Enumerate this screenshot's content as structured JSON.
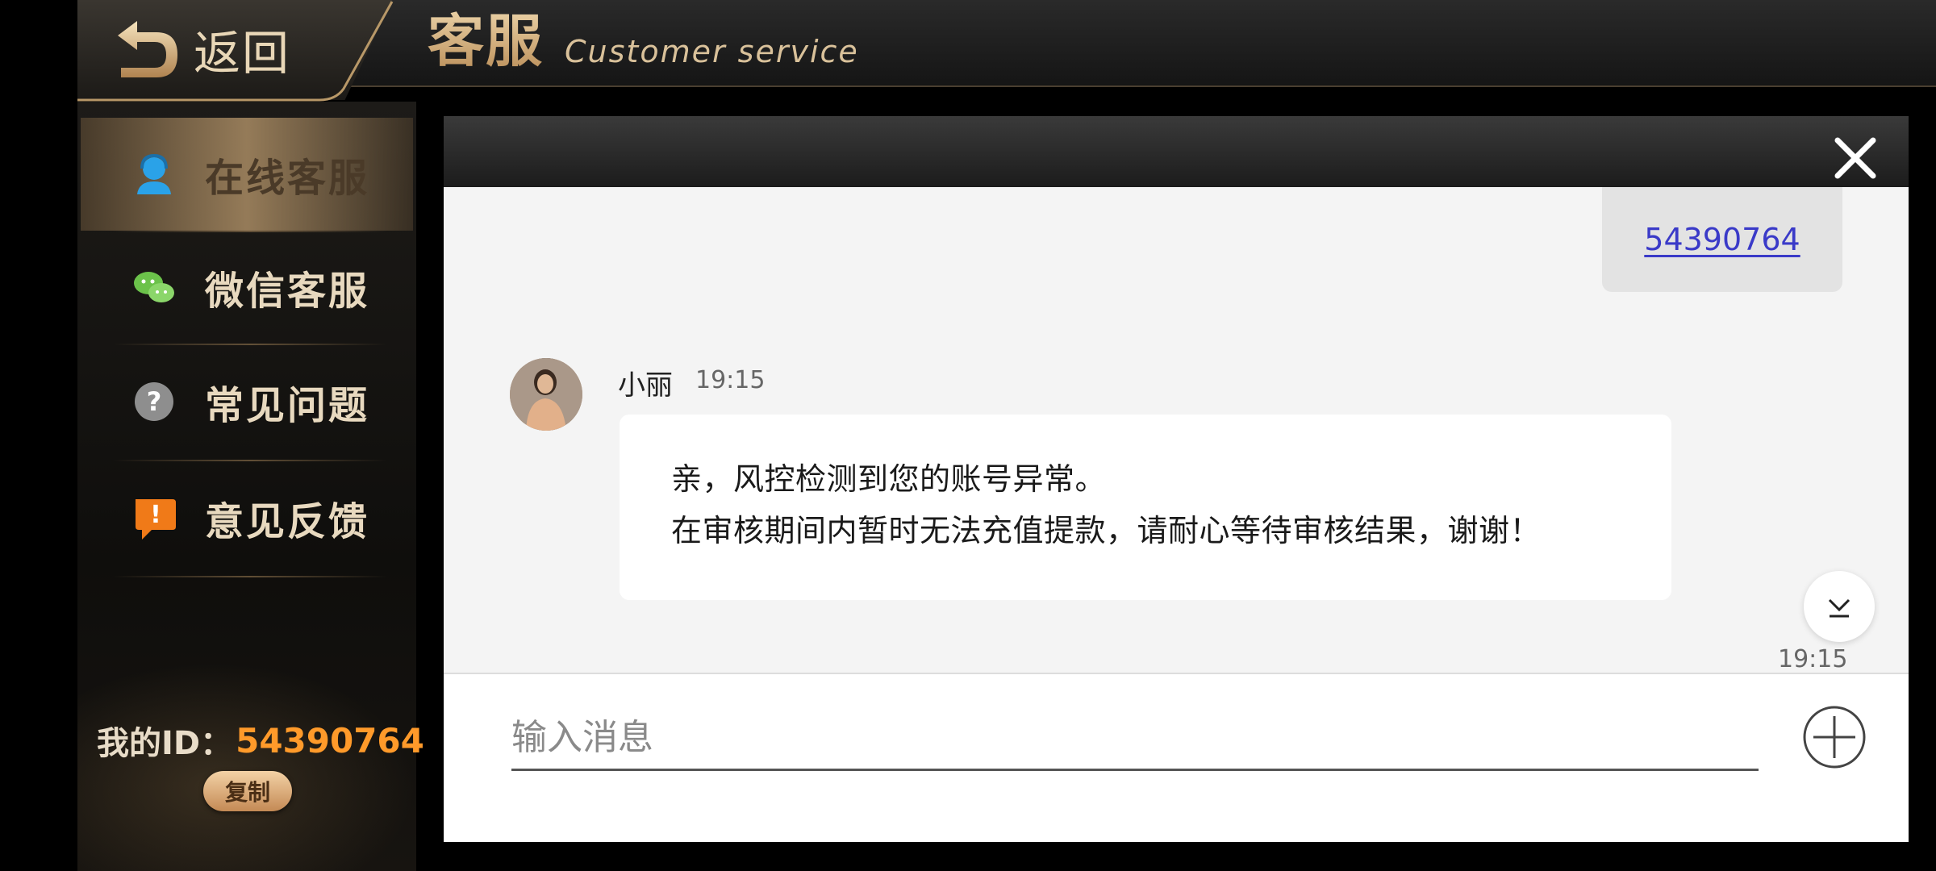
{
  "header": {
    "back_label": "返回",
    "title_cn": "客服",
    "title_en": "Customer service"
  },
  "sidebar": {
    "items": [
      {
        "label": "在线客服",
        "icon": "agent-icon",
        "active": true
      },
      {
        "label": "微信客服",
        "icon": "wechat-icon",
        "active": false
      },
      {
        "label": "常见问题",
        "icon": "question-icon",
        "active": false
      },
      {
        "label": "意见反馈",
        "icon": "feedback-icon",
        "active": false
      }
    ],
    "my_id_label": "我的ID：",
    "my_id_value": "54390764",
    "copy_label": "复制"
  },
  "chat": {
    "my_message_link": "54390764",
    "agent_name": "小丽",
    "agent_time": "19:15",
    "agent_message_line1": "亲，风控检测到您的账号异常。",
    "agent_message_line2": "在审核期间内暂时无法充值提款，请耐心等待审核结果，谢谢！",
    "bottom_time": "19:15",
    "input_placeholder": "输入消息"
  },
  "colors": {
    "accent_gold": "#d8b98a",
    "id_orange": "#ff9a2a",
    "link_blue": "#3a3ac8"
  }
}
